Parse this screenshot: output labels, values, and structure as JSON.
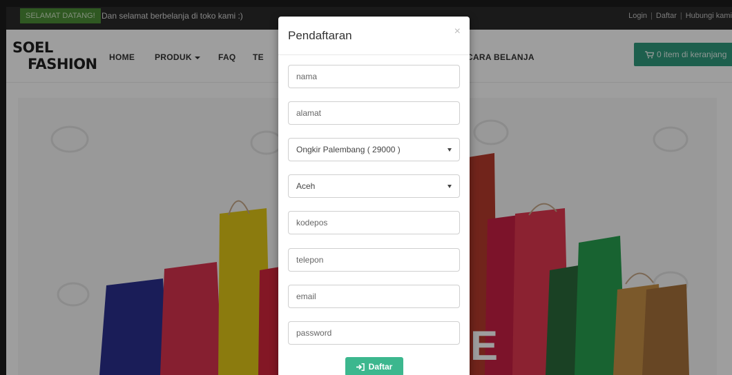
{
  "topbar": {
    "welcome_badge": "SELAMAT DATANG!",
    "welcome_text": "Dan selamat berbelanja di toko kami :)",
    "links": [
      "Login",
      "Daftar",
      "Hubungi kami"
    ]
  },
  "navbar": {
    "logo_line1": "SOEL",
    "logo_line2": "FASHION",
    "items": [
      "HOME",
      "PRODUK",
      "FAQ",
      "TE",
      "CARA BELANJA"
    ],
    "cart_label": "0 item di keranjang"
  },
  "modal": {
    "title": "Pendaftaran",
    "close_symbol": "×",
    "fields": {
      "nama": "nama",
      "alamat": "alamat",
      "ongkir_selected": "Ongkir Palembang ( 29000 )",
      "province_selected": "Aceh",
      "kodepos": "kodepos",
      "telepon": "telepon",
      "email": "email",
      "password": "password"
    },
    "submit_label": "Daftar"
  },
  "colors": {
    "accent_green": "#4d8f37",
    "cart_teal": "#2f9a7c",
    "submit_green": "#3cb78e"
  },
  "icons": {
    "cart": "cart-icon",
    "submit": "sign-in-icon",
    "close": "close-icon"
  }
}
